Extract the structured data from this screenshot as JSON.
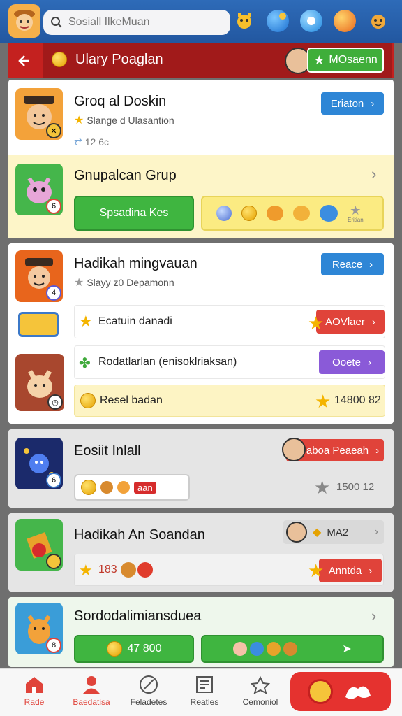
{
  "search": {
    "placeholder": "Sosiall IlkeMuan",
    "value": ""
  },
  "header": {
    "title": "Ulary Poaglan",
    "action_label": "MOsaenn"
  },
  "cards": [
    {
      "title": "Groq al Doskin",
      "subtitle": "Slange d Ulasantion",
      "meta": "12 6c",
      "action_label": "Eriaton",
      "group": {
        "title": "Gnupalcan Grup",
        "button_label": "Spsadina Kes",
        "badge_text": "Eritian"
      }
    },
    {
      "title": "Hadikah mingvauan",
      "subtitle": "Slayy z0 Depamonn",
      "action_label": "Reace",
      "rows": [
        {
          "label": "Ecatuin danadi",
          "button_label": "AOVlaer"
        },
        {
          "label": "Rodatlarlan (enisoklriaksan)",
          "button_label": "Ooete"
        },
        {
          "label": "Resel badan",
          "value": "14800 82"
        }
      ]
    },
    {
      "title": "Eosiit Inlall",
      "action_label": "aboa Peaeah",
      "coin_tag": "aan",
      "value": "1500 12"
    },
    {
      "title": "Hadikah An Soandan",
      "action_label": "MA2",
      "count": "183",
      "button_label": "Anntda"
    },
    {
      "title": "Sordodalimiansduea",
      "count": "47 800"
    }
  ],
  "nav": [
    {
      "label": "Rade"
    },
    {
      "label": "Baedatisa"
    },
    {
      "label": "Feladetes"
    },
    {
      "label": "Reatles"
    },
    {
      "label": "Cemoniol"
    }
  ],
  "colors": {
    "topbar": "#2e6bb8",
    "header_red": "#c4211f",
    "green": "#3fb540",
    "blue": "#2e86d6",
    "red": "#e0433a",
    "purple": "#8a5ad8"
  }
}
